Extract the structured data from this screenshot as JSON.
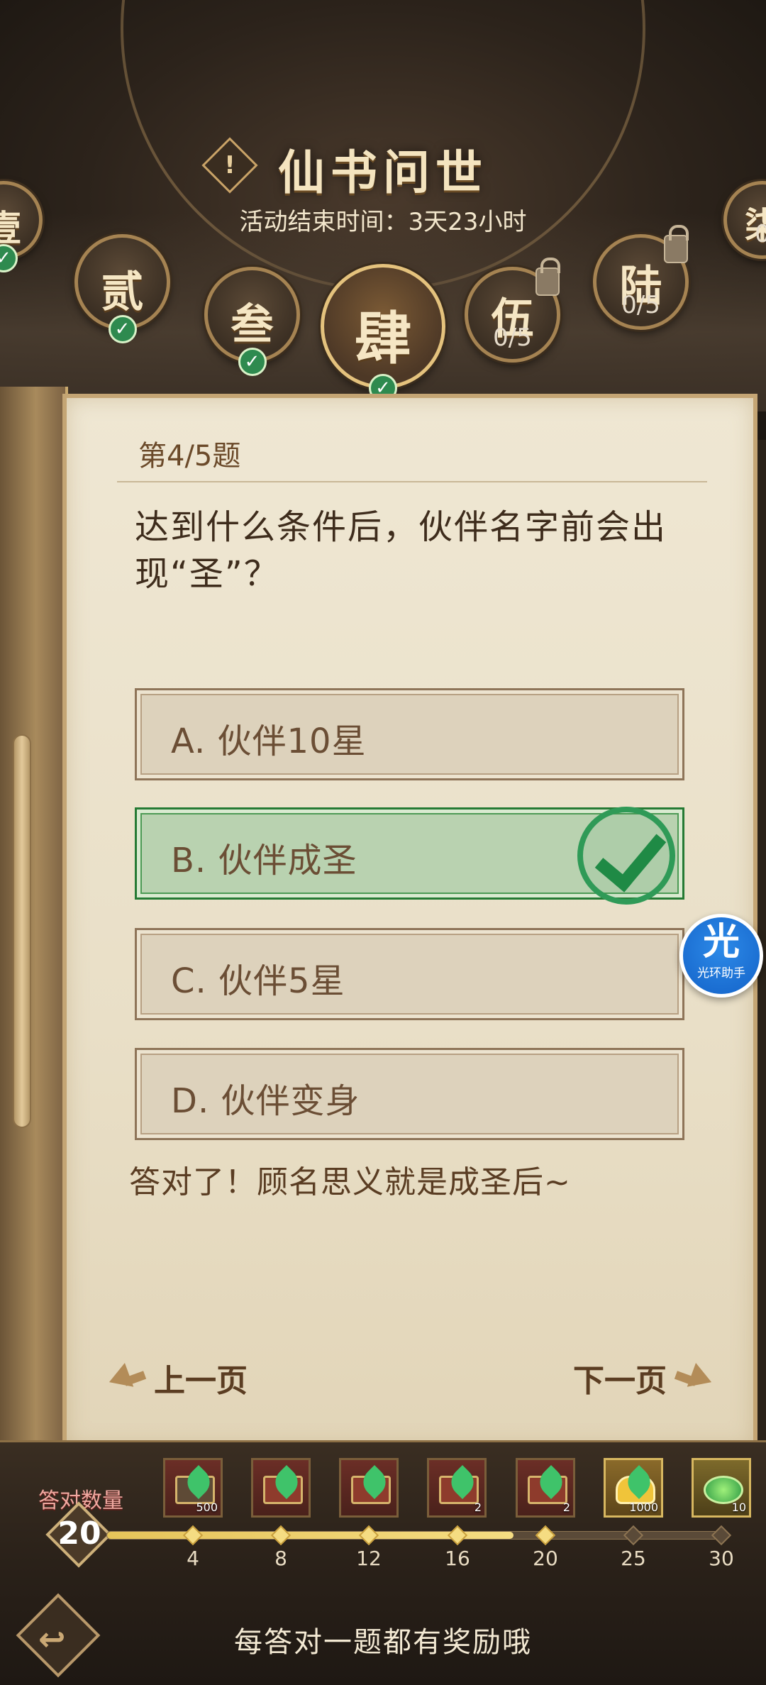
{
  "header": {
    "title": "仙书问世",
    "end_time": "活动结束时间：3天23小时",
    "alert_icon": "!"
  },
  "chapters": [
    {
      "label": "壹",
      "status": "done",
      "progress": ""
    },
    {
      "label": "贰",
      "status": "done",
      "progress": ""
    },
    {
      "label": "叁",
      "status": "done",
      "progress": ""
    },
    {
      "label": "肆",
      "status": "active",
      "progress": ""
    },
    {
      "label": "伍",
      "status": "locked",
      "progress": "0/5"
    },
    {
      "label": "陆",
      "status": "locked",
      "progress": "0/5"
    },
    {
      "label": "柒",
      "status": "locked",
      "progress": "0"
    }
  ],
  "question": {
    "number": "第4/5题",
    "text": "达到什么条件后，伙伴名字前会出现“圣”？",
    "options": [
      {
        "label": "A. 伙伴10星",
        "correct": false
      },
      {
        "label": "B. 伙伴成圣",
        "correct": true
      },
      {
        "label": "C. 伙伴5星",
        "correct": false
      },
      {
        "label": "D. 伙伴变身",
        "correct": false
      }
    ],
    "feedback": "答对了！顾名思义就是成圣后~"
  },
  "nav": {
    "prev": "上一页",
    "next": "下一页"
  },
  "helper": {
    "big": "光",
    "small": "光环助手"
  },
  "progress": {
    "label": "答对数量",
    "value": "20",
    "fill_fraction": 0.66,
    "milestones": [
      {
        "label": "4",
        "done": true
      },
      {
        "label": "8",
        "done": true
      },
      {
        "label": "12",
        "done": true
      },
      {
        "label": "16",
        "done": true
      },
      {
        "label": "20",
        "done": true
      },
      {
        "label": "25",
        "done": false
      },
      {
        "label": "30",
        "done": false
      }
    ],
    "rewards": [
      {
        "kind": "first",
        "qty": "500"
      },
      {
        "kind": "chest",
        "qty": ""
      },
      {
        "kind": "chest",
        "qty": ""
      },
      {
        "kind": "chest",
        "qty": "2"
      },
      {
        "kind": "chest",
        "qty": "2"
      },
      {
        "kind": "gold",
        "qty": "1000"
      },
      {
        "kind": "jade",
        "qty": "10"
      }
    ]
  },
  "footer": {
    "tip": "每答对一题都有奖励哦",
    "back_icon": "back-arrow-icon"
  },
  "colors": {
    "correct_green": "#2f9a57",
    "paper": "#efe7d3",
    "gold_accent": "#c4a574"
  }
}
